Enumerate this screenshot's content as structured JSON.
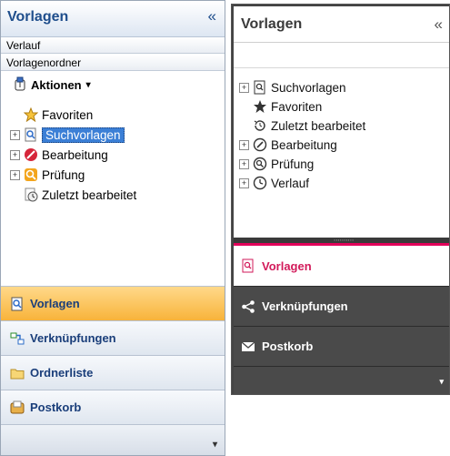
{
  "left": {
    "title": "Vorlagen",
    "collapse_glyph": "«",
    "bars": [
      "Verlauf",
      "Vorlagenordner"
    ],
    "actions_label": "Aktionen",
    "actions_caret": "▾",
    "tree": [
      {
        "label": "Favoriten",
        "icon": "star-icon",
        "expander": false
      },
      {
        "label": "Suchvorlagen",
        "icon": "search-template-icon",
        "expander": true,
        "selected": true
      },
      {
        "label": "Bearbeitung",
        "icon": "edit-icon",
        "expander": true
      },
      {
        "label": "Prüfung",
        "icon": "review-icon",
        "expander": true
      },
      {
        "label": "Zuletzt bearbeitet",
        "icon": "recent-icon",
        "expander": false
      }
    ],
    "nav": [
      {
        "label": "Vorlagen",
        "icon": "templates-icon",
        "active": true
      },
      {
        "label": "Verknüpfungen",
        "icon": "links-icon"
      },
      {
        "label": "Ordnerliste",
        "icon": "folder-icon"
      },
      {
        "label": "Postkorb",
        "icon": "inbox-icon"
      }
    ],
    "nav_more": "▾"
  },
  "right": {
    "title": "Vorlagen",
    "collapse_glyph": "«",
    "tree": [
      {
        "label": "Suchvorlagen",
        "icon": "search-template-icon",
        "expander": true
      },
      {
        "label": "Favoriten",
        "icon": "star-icon",
        "expander": false
      },
      {
        "label": "Zuletzt bearbeitet",
        "icon": "recent-icon",
        "expander": false
      },
      {
        "label": "Bearbeitung",
        "icon": "edit-icon",
        "expander": true
      },
      {
        "label": "Prüfung",
        "icon": "review-icon",
        "expander": true
      },
      {
        "label": "Verlauf",
        "icon": "clock-icon",
        "expander": true
      }
    ],
    "grip": "∙∙∙∙∙∙∙∙∙∙",
    "nav": [
      {
        "label": "Vorlagen",
        "icon": "search-template-icon",
        "active": true
      },
      {
        "label": "Verknüpfungen",
        "icon": "share-icon"
      },
      {
        "label": "Postkorb",
        "icon": "mail-icon"
      }
    ],
    "nav_more": "▾"
  },
  "colors": {
    "accent_left": "#f8b33a",
    "accent_right": "#e2005a",
    "title_blue": "#1f4e8c"
  }
}
